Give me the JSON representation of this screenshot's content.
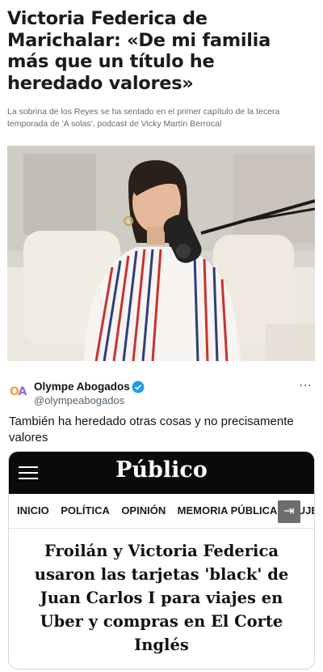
{
  "article": {
    "headline": "Victoria Federica de Marichalar: «De mi familia más que un título he heredado valores»",
    "subtitle": "La sobrina de los Reyes se ha sentado en el primer capítulo de la tecera temporada de 'A solas', podcast de Vicky Martín Berrocal"
  },
  "post": {
    "display_name": "Olympe Abogados",
    "handle": "@olympeabogados",
    "verified": true,
    "more_icon": "⋯",
    "avatar_letters": [
      "O",
      "A"
    ],
    "text": "También ha heredado otras cosas y no precisamente valores"
  },
  "card": {
    "masthead": "Público",
    "nav_items": [
      "INICIO",
      "POLÍTICA",
      "OPINIÓN",
      "MEMORIA PÚBLICA",
      "MUJER"
    ],
    "nav_arrow": "⇥",
    "title": "Froilán y Victoria Federica usaron las tarjetas 'black' de Juan Carlos I para viajes en Uber y compras en El Corte Inglés"
  },
  "colors": {
    "verified_badge": "#1d9bf0",
    "masthead_bg": "#0a0a0a"
  }
}
